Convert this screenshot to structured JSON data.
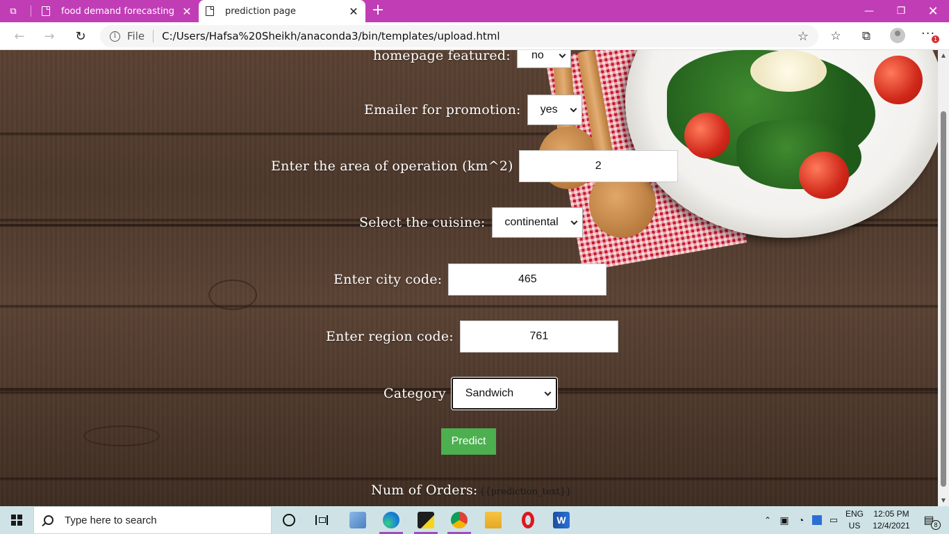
{
  "browser": {
    "tabs": [
      {
        "title": "food demand forecasting",
        "active": false
      },
      {
        "title": "prediction page",
        "active": true
      }
    ],
    "address": {
      "scheme": "File",
      "url": "C:/Users/Hafsa%20Sheikh/anaconda3/bin/templates/upload.html"
    },
    "notification_badge": "1"
  },
  "form": {
    "homepage_featured": {
      "label": "homepage featured:",
      "value": "no"
    },
    "emailer": {
      "label": "Emailer for promotion:",
      "value": "yes"
    },
    "area": {
      "label": "Enter the area of operation (km^2)",
      "value": "2"
    },
    "cuisine": {
      "label": "Select the cuisine:",
      "value": "continental"
    },
    "city": {
      "label": "Enter city code:",
      "value": "465"
    },
    "region": {
      "label": "Enter region code:",
      "value": "761"
    },
    "category": {
      "label": "Category",
      "value": "Sandwich"
    },
    "predict_label": "Predict",
    "result_label": "Num of Orders:",
    "result_text": "{{prediction_text}}"
  },
  "taskbar": {
    "search_placeholder": "Type here to search",
    "language": [
      "ENG",
      "US"
    ],
    "time": "12:05 PM",
    "date": "12/4/2021",
    "notifications": "8"
  },
  "colors": {
    "tabbar": "#c13db6",
    "predict": "#4caf50"
  }
}
